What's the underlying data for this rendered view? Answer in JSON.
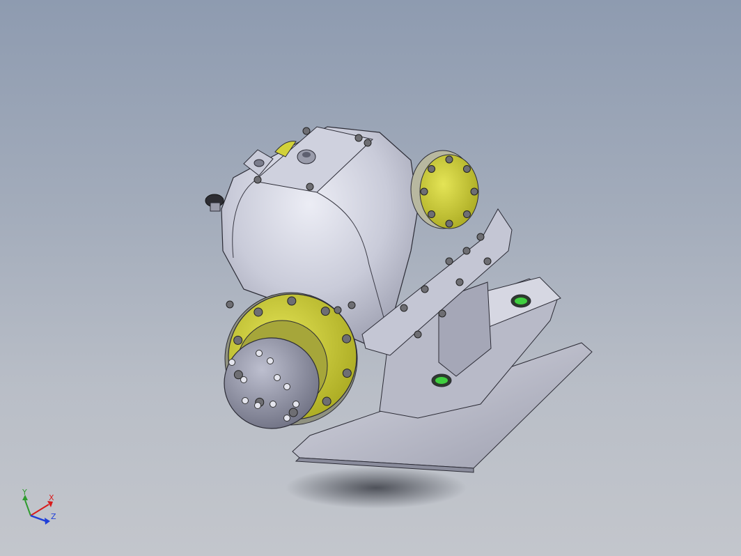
{
  "viewport": {
    "background_top": "#8e9bb0",
    "background_bottom": "#c3c6cc"
  },
  "model": {
    "body_color": "#c9cbd9",
    "flange_color": "#d2d23a",
    "port_color": "#3fcf3f",
    "bolt_color": "#6e6e73"
  },
  "triad": {
    "x_label": "X",
    "y_label": "Y",
    "z_label": "Z",
    "x_color": "#d81b1b",
    "y_color": "#2e9b2e",
    "z_color": "#1f3fd8"
  }
}
